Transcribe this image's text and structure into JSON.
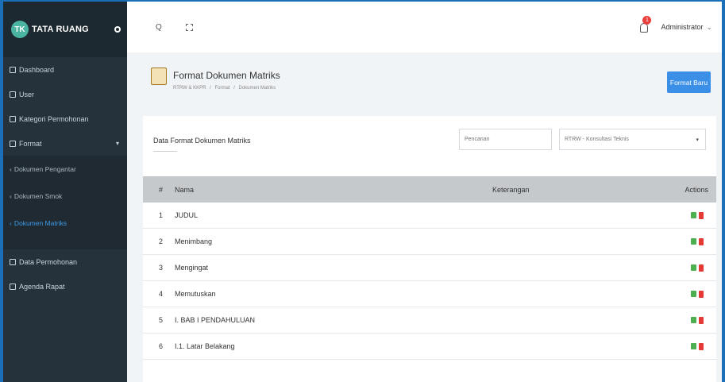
{
  "brand": {
    "logo": "TK",
    "name": "TATA RUANG",
    "toggle_icon": "circle-toggle-icon"
  },
  "sidebar": {
    "items": [
      {
        "label": "Dashboard"
      },
      {
        "label": "User"
      },
      {
        "label": "Kategori Permohonan"
      },
      {
        "label": "Format"
      }
    ],
    "sub_items": [
      {
        "label": "Dokumen Pengantar"
      },
      {
        "label": "Dokumen Smok"
      },
      {
        "label": "Dokumen Matriks"
      }
    ],
    "items_after": [
      {
        "label": "Data Permohonan"
      },
      {
        "label": "Agenda Rapat"
      }
    ]
  },
  "topbar": {
    "search_icon": "Q",
    "notification_count": "1",
    "user": "Administrator",
    "user_caret": "⌄"
  },
  "page": {
    "title": "Format Dokumen Matriks",
    "breadcrumb": [
      "RTRW & KKPR",
      "/",
      "Format",
      "/",
      "Dokumen Matriks"
    ],
    "new_button": "Format Baru"
  },
  "card": {
    "title": "Data Format Dokumen Matriks",
    "search_placeholder": "Pencarian",
    "select_value": "RTRW - Konsultasi Teknis",
    "select_caret": "▾"
  },
  "table": {
    "headers": {
      "num": "#",
      "name": "Nama",
      "ket": "Keterangan",
      "act": "Actions"
    },
    "rows": [
      {
        "num": "1",
        "name": "JUDUL",
        "ket": ""
      },
      {
        "num": "2",
        "name": "Menimbang",
        "ket": ""
      },
      {
        "num": "3",
        "name": "Mengingat",
        "ket": ""
      },
      {
        "num": "4",
        "name": "Memutuskan",
        "ket": ""
      },
      {
        "num": "5",
        "name": "I. BAB I PENDAHULUAN",
        "ket": ""
      },
      {
        "num": "6",
        "name": "I.1. Latar Belakang",
        "ket": ""
      }
    ]
  },
  "colors": {
    "sidebar": "#26323b",
    "accent": "#1b6fb8",
    "button": "#3b8fe6",
    "edit": "#4caf50",
    "delete": "#e53935"
  }
}
